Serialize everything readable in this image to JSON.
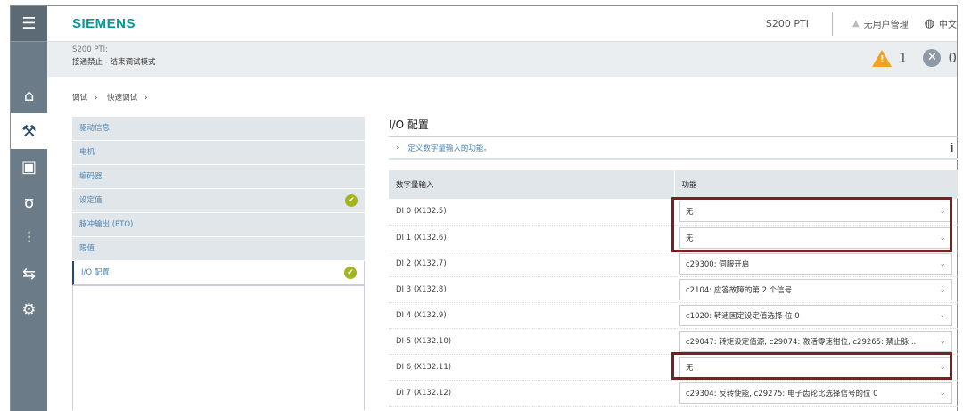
{
  "header": {
    "logo": "SIEMENS",
    "device": "S200 PTI",
    "user": "无用户管理",
    "language": "中文"
  },
  "status": {
    "device_label": "S200 PTI:",
    "mode": "接通禁止 - 结束调试模式",
    "warnings": "1",
    "errors": "0"
  },
  "breadcrumb": [
    "调试",
    "快速调试"
  ],
  "nav": [
    {
      "label": "驱动信息",
      "done": false
    },
    {
      "label": "电机",
      "done": false
    },
    {
      "label": "编码器",
      "done": false
    },
    {
      "label": "设定值",
      "done": true
    },
    {
      "label": "脉冲输出 (PTO)",
      "done": false
    },
    {
      "label": "限值",
      "done": false
    },
    {
      "label": "I/O 配置",
      "done": true,
      "selected": true
    }
  ],
  "main": {
    "title": "I/O 配置",
    "info": "定义数字量输入的功能。",
    "table": {
      "headers": [
        "数字量输入",
        "功能"
      ],
      "rows": [
        {
          "input": "DI 0 (X132.5)",
          "function": "无"
        },
        {
          "input": "DI 1 (X132.6)",
          "function": "无"
        },
        {
          "input": "DI 2 (X132.7)",
          "function": "c29300: 伺服开启"
        },
        {
          "input": "DI 3 (X132.8)",
          "function": "c2104: 应答故障的第 2 个信号"
        },
        {
          "input": "DI 4 (X132.9)",
          "function": "c1020: 转速固定设定值选择 位 0"
        },
        {
          "input": "DI 5 (X132.10)",
          "function": "c29047: 转矩设定值源, c29074: 激活零速钳位, c29265: 禁止脉..."
        },
        {
          "input": "DI 6 (X132.11)",
          "function": "无"
        },
        {
          "input": "DI 7 (X132.12)",
          "function": "c29304: 反转使能, c29275: 电子齿轮比选择信号的位 0"
        }
      ]
    }
  },
  "colors": {
    "brand": "#009999",
    "highlight": "#7a2020",
    "check": "#a5b51f",
    "warning": "#f0a321"
  }
}
